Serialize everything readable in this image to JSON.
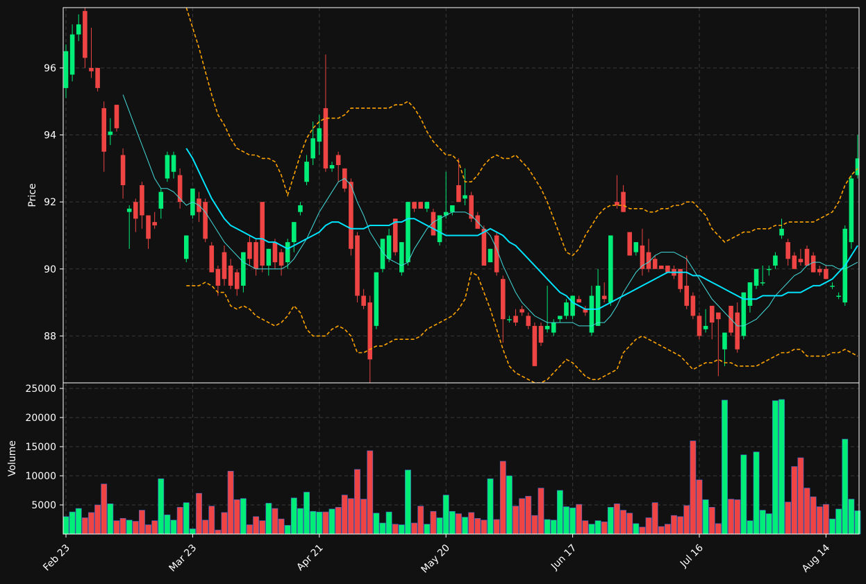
{
  "chart_data": {
    "type": "candlestick",
    "colors": {
      "background": "#111111",
      "up": "#00ee77",
      "down": "#ee4444",
      "volume_edge": "#4466cc",
      "ma_fast": "#44dddd",
      "ma_slow": "#00e5ff",
      "bollinger": "#ffa500",
      "grid": "#3a3a3a",
      "text": "#ffffff"
    },
    "price_panel": {
      "ylabel": "Price",
      "ylim": [
        86.6,
        97.8
      ],
      "yticks": [
        88,
        90,
        92,
        94,
        96
      ]
    },
    "volume_panel": {
      "ylabel": "Volume",
      "ylim": [
        0,
        25000
      ],
      "yticks": [
        5000,
        10000,
        15000,
        20000,
        25000
      ]
    },
    "x_ticks": [
      {
        "index": 0,
        "label": "Feb 23"
      },
      {
        "index": 20,
        "label": "Mar 23"
      },
      {
        "index": 40,
        "label": "Apr 21"
      },
      {
        "index": 60,
        "label": "May 20"
      },
      {
        "index": 80,
        "label": "Jun 17"
      },
      {
        "index": 100,
        "label": "Jul 16"
      },
      {
        "index": 120,
        "label": "Aug 14"
      }
    ],
    "ohlc": [
      [
        95.4,
        96.7,
        95.1,
        96.5
      ],
      [
        95.8,
        97.3,
        95.6,
        97.0
      ],
      [
        97.0,
        97.6,
        96.8,
        97.3
      ],
      [
        97.7,
        98.0,
        96.0,
        96.3
      ],
      [
        96.0,
        97.2,
        95.7,
        95.9
      ],
      [
        96.0,
        96.0,
        95.3,
        95.4
      ],
      [
        94.8,
        95.0,
        92.9,
        93.5
      ],
      [
        94.0,
        94.5,
        93.7,
        94.1
      ],
      [
        94.9,
        94.9,
        94.1,
        94.2
      ],
      [
        93.4,
        93.6,
        92.1,
        92.5
      ],
      [
        91.7,
        91.9,
        90.6,
        91.8
      ],
      [
        92.0,
        92.1,
        91.1,
        91.5
      ],
      [
        92.5,
        92.6,
        91.2,
        91.6
      ],
      [
        91.6,
        91.6,
        90.6,
        90.9
      ],
      [
        91.4,
        91.7,
        91.2,
        91.3
      ],
      [
        91.8,
        92.4,
        91.5,
        92.3
      ],
      [
        92.7,
        93.5,
        92.6,
        93.4
      ],
      [
        92.9,
        93.5,
        92.7,
        93.4
      ],
      [
        92.8,
        93.0,
        91.8,
        92.0
      ],
      [
        90.3,
        91.0,
        90.2,
        91.0
      ],
      [
        91.6,
        92.4,
        91.5,
        92.4
      ],
      [
        92.1,
        92.3,
        91.4,
        91.7
      ],
      [
        92.0,
        92.1,
        90.8,
        90.9
      ],
      [
        90.7,
        90.8,
        89.9,
        89.9
      ],
      [
        90.0,
        90.1,
        89.2,
        89.5
      ],
      [
        90.5,
        90.7,
        89.5,
        89.7
      ],
      [
        90.1,
        90.3,
        89.4,
        89.5
      ],
      [
        89.9,
        90.0,
        89.2,
        89.4
      ],
      [
        89.5,
        90.5,
        89.3,
        90.5
      ],
      [
        90.8,
        91.0,
        90.1,
        90.3
      ],
      [
        90.8,
        90.9,
        89.8,
        90.0
      ],
      [
        92.0,
        92.0,
        89.9,
        90.1
      ],
      [
        90.1,
        90.6,
        89.8,
        90.6
      ],
      [
        90.8,
        90.9,
        90.0,
        90.2
      ],
      [
        90.5,
        90.6,
        89.8,
        90.1
      ],
      [
        90.2,
        90.9,
        90.0,
        90.8
      ],
      [
        90.8,
        91.4,
        90.5,
        91.4
      ],
      [
        91.7,
        92.0,
        91.6,
        91.9
      ],
      [
        92.6,
        93.4,
        92.5,
        93.2
      ],
      [
        93.3,
        94.4,
        93.1,
        93.9
      ],
      [
        93.8,
        94.6,
        93.4,
        94.2
      ],
      [
        94.8,
        96.4,
        92.9,
        93.0
      ],
      [
        93.0,
        93.2,
        92.9,
        93.1
      ],
      [
        93.4,
        93.5,
        92.6,
        93.1
      ],
      [
        93.0,
        93.0,
        92.3,
        92.4
      ],
      [
        92.6,
        92.7,
        90.4,
        90.6
      ],
      [
        91.0,
        91.1,
        89.0,
        89.2
      ],
      [
        89.2,
        89.4,
        88.8,
        88.9
      ],
      [
        89.0,
        89.2,
        86.5,
        87.3
      ],
      [
        88.3,
        89.9,
        88.2,
        89.9
      ],
      [
        90.0,
        90.9,
        89.9,
        90.9
      ],
      [
        90.3,
        91.2,
        90.2,
        91.0
      ],
      [
        91.5,
        91.5,
        90.4,
        90.5
      ],
      [
        89.9,
        90.8,
        89.8,
        90.8
      ],
      [
        90.2,
        92.0,
        90.1,
        92.0
      ],
      [
        92.0,
        92.0,
        91.7,
        91.8
      ],
      [
        92.0,
        92.0,
        91.8,
        91.8
      ],
      [
        91.8,
        92.0,
        91.7,
        92.0
      ],
      [
        91.7,
        91.8,
        91.0,
        91.0
      ],
      [
        90.8,
        91.6,
        90.7,
        91.6
      ],
      [
        91.6,
        92.9,
        91.5,
        91.7
      ],
      [
        91.7,
        91.8,
        91.6,
        91.9
      ],
      [
        92.5,
        93.3,
        92.0,
        92.0
      ],
      [
        92.1,
        93.0,
        91.9,
        92.2
      ],
      [
        92.2,
        92.3,
        91.4,
        91.5
      ],
      [
        91.6,
        91.7,
        91.2,
        91.2
      ],
      [
        91.2,
        91.3,
        90.1,
        90.1
      ],
      [
        90.2,
        90.6,
        90.2,
        90.6
      ],
      [
        91.0,
        91.1,
        89.8,
        89.9
      ],
      [
        89.7,
        89.8,
        87.8,
        88.5
      ],
      [
        88.5,
        88.6,
        88.4,
        88.5
      ],
      [
        88.6,
        88.8,
        88.3,
        88.4
      ],
      [
        88.8,
        88.9,
        88.6,
        88.7
      ],
      [
        88.6,
        88.7,
        88.2,
        88.3
      ],
      [
        88.3,
        88.4,
        87.1,
        87.1
      ],
      [
        88.3,
        88.4,
        87.7,
        87.8
      ],
      [
        88.2,
        89.5,
        88.1,
        88.3
      ],
      [
        88.1,
        88.5,
        88.0,
        88.4
      ],
      [
        88.5,
        88.6,
        88.4,
        88.6
      ],
      [
        88.6,
        89.1,
        88.5,
        89.0
      ],
      [
        88.6,
        89.2,
        88.5,
        89.2
      ],
      [
        89.1,
        89.2,
        89.0,
        89.0
      ],
      [
        88.8,
        88.9,
        88.6,
        88.7
      ],
      [
        88.1,
        89.5,
        88.0,
        89.2
      ],
      [
        88.3,
        90.0,
        88.3,
        89.5
      ],
      [
        89.2,
        89.6,
        89.0,
        89.1
      ],
      [
        89.0,
        91.0,
        88.9,
        91.0
      ],
      [
        92.0,
        92.8,
        91.8,
        91.9
      ],
      [
        92.3,
        92.5,
        91.7,
        91.7
      ],
      [
        91.1,
        91.1,
        90.4,
        90.4
      ],
      [
        90.5,
        90.8,
        90.4,
        90.8
      ],
      [
        90.7,
        91.2,
        89.8,
        90.0
      ],
      [
        90.5,
        90.9,
        89.9,
        90.0
      ],
      [
        90.3,
        90.4,
        90.0,
        90.0
      ],
      [
        90.1,
        90.1,
        90.0,
        90.0
      ],
      [
        90.1,
        90.1,
        89.9,
        89.9
      ],
      [
        90.0,
        90.1,
        89.7,
        89.8
      ],
      [
        90.0,
        90.0,
        89.3,
        89.4
      ],
      [
        89.5,
        90.4,
        88.8,
        88.9
      ],
      [
        89.2,
        89.3,
        88.5,
        88.6
      ],
      [
        88.6,
        88.7,
        87.9,
        88.0
      ],
      [
        88.2,
        88.8,
        88.1,
        88.3
      ],
      [
        88.9,
        88.9,
        87.9,
        88.4
      ],
      [
        88.7,
        88.7,
        86.8,
        88.5
      ],
      [
        87.6,
        88.1,
        87.1,
        88.1
      ],
      [
        88.9,
        88.9,
        88.0,
        88.1
      ],
      [
        88.7,
        89.0,
        87.5,
        87.6
      ],
      [
        88.0,
        89.3,
        87.9,
        89.3
      ],
      [
        88.9,
        89.6,
        88.7,
        89.6
      ],
      [
        89.5,
        90.0,
        89.4,
        90.0
      ],
      [
        89.6,
        90.1,
        89.5,
        89.6
      ],
      [
        90.0,
        90.1,
        89.8,
        90.0
      ],
      [
        90.1,
        90.5,
        90.0,
        90.4
      ],
      [
        91.0,
        91.5,
        90.9,
        91.2
      ],
      [
        90.8,
        90.9,
        90.1,
        90.3
      ],
      [
        90.4,
        90.5,
        90.0,
        90.0
      ],
      [
        90.3,
        90.6,
        90.1,
        90.2
      ],
      [
        90.6,
        90.7,
        90.1,
        90.1
      ],
      [
        90.4,
        90.5,
        89.9,
        89.9
      ],
      [
        90.0,
        90.1,
        89.8,
        89.9
      ],
      [
        90.0,
        90.1,
        89.7,
        89.7
      ],
      [
        89.5,
        89.6,
        89.4,
        89.5
      ],
      [
        89.2,
        89.3,
        89.1,
        89.2
      ],
      [
        89.0,
        91.3,
        88.9,
        91.2
      ],
      [
        90.8,
        92.8,
        90.6,
        92.7
      ],
      [
        92.8,
        94.0,
        92.7,
        93.3
      ]
    ],
    "volume": [
      3000,
      3800,
      4400,
      2800,
      3700,
      5000,
      8600,
      5200,
      2300,
      2700,
      2400,
      2200,
      4100,
      1600,
      2300,
      9500,
      3300,
      2400,
      4600,
      5400,
      900,
      7000,
      2400,
      4800,
      700,
      3700,
      10800,
      5900,
      6100,
      1600,
      3000,
      2300,
      5300,
      4400,
      2600,
      1500,
      6200,
      4400,
      7200,
      3900,
      3800,
      3800,
      4300,
      4600,
      6700,
      6100,
      11100,
      6000,
      14300,
      3600,
      1900,
      3800,
      1700,
      1600,
      11000,
      1900,
      4800,
      1700,
      3900,
      2800,
      6700,
      3900,
      3500,
      2900,
      3700,
      2700,
      2400,
      9500,
      2500,
      12500,
      10000,
      4800,
      6100,
      6500,
      3200,
      7900,
      2500,
      2400,
      7500,
      4700,
      4500,
      5100,
      2300,
      1700,
      2300,
      2100,
      4600,
      5200,
      4100,
      3600,
      1800,
      1200,
      2800,
      5400,
      1300,
      1700,
      3200,
      3000,
      4900,
      16000,
      9300,
      5900,
      4600,
      1800,
      23000,
      6000,
      5900,
      13600,
      2300,
      14100,
      4100,
      3500,
      22900,
      23100,
      5500,
      11600,
      13100,
      7900,
      6400,
      4700,
      5100,
      2600,
      4300,
      16300,
      6000,
      4000
    ],
    "ma_fast": [
      null,
      null,
      null,
      null,
      null,
      null,
      null,
      null,
      null,
      95.2,
      94.7,
      94.2,
      93.7,
      93.2,
      92.7,
      92.4,
      92.4,
      92.3,
      92.1,
      91.9,
      92.0,
      91.9,
      91.7,
      91.4,
      91.1,
      90.8,
      90.6,
      90.4,
      90.2,
      90.1,
      90.0,
      90.0,
      90.0,
      90.0,
      90.0,
      90.1,
      90.3,
      90.6,
      90.9,
      91.3,
      91.7,
      92.0,
      92.3,
      92.6,
      92.7,
      92.5,
      92.0,
      91.6,
      91.1,
      90.8,
      90.5,
      90.3,
      90.2,
      90.1,
      90.2,
      90.6,
      90.9,
      91.2,
      91.4,
      91.5,
      91.6,
      91.7,
      91.7,
      91.7,
      91.6,
      91.4,
      91.2,
      91.0,
      90.6,
      90.1,
      89.7,
      89.3,
      89.0,
      88.8,
      88.6,
      88.5,
      88.4,
      88.4,
      88.4,
      88.4,
      88.4,
      88.3,
      88.3,
      88.3,
      88.4,
      88.4,
      88.6,
      88.9,
      89.3,
      89.6,
      89.9,
      90.1,
      90.2,
      90.4,
      90.5,
      90.5,
      90.5,
      90.4,
      90.3,
      90.0,
      89.7,
      89.4,
      89.1,
      88.9,
      88.7,
      88.5,
      88.3,
      88.3,
      88.4,
      88.5,
      88.7,
      88.9,
      89.2,
      89.4,
      89.6,
      89.8,
      89.9,
      90.1,
      90.2,
      90.2,
      90.1,
      90.1,
      90.0,
      90.0,
      90.1,
      90.2
    ],
    "ma_slow": [
      null,
      null,
      null,
      null,
      null,
      null,
      null,
      null,
      null,
      null,
      null,
      null,
      null,
      null,
      null,
      null,
      null,
      null,
      null,
      93.6,
      93.3,
      92.9,
      92.5,
      92.1,
      91.8,
      91.5,
      91.3,
      91.2,
      91.1,
      91.0,
      90.9,
      90.9,
      90.8,
      90.8,
      90.7,
      90.6,
      90.7,
      90.8,
      90.9,
      91.0,
      91.1,
      91.3,
      91.4,
      91.4,
      91.3,
      91.2,
      91.2,
      91.2,
      91.3,
      91.3,
      91.3,
      91.3,
      91.4,
      91.4,
      91.5,
      91.5,
      91.4,
      91.3,
      91.2,
      91.1,
      91.0,
      91.0,
      91.0,
      91.0,
      91.0,
      91.0,
      91.1,
      91.2,
      91.1,
      91.0,
      90.8,
      90.7,
      90.5,
      90.3,
      90.1,
      89.9,
      89.7,
      89.5,
      89.3,
      89.2,
      89.0,
      88.9,
      88.8,
      88.8,
      88.8,
      88.9,
      89.0,
      89.1,
      89.2,
      89.3,
      89.4,
      89.5,
      89.6,
      89.7,
      89.8,
      89.9,
      89.9,
      89.9,
      89.9,
      89.8,
      89.8,
      89.7,
      89.6,
      89.5,
      89.4,
      89.3,
      89.2,
      89.1,
      89.1,
      89.1,
      89.2,
      89.2,
      89.2,
      89.2,
      89.3,
      89.3,
      89.3,
      89.4,
      89.5,
      89.5,
      89.6,
      89.7,
      89.9,
      90.1,
      90.4,
      90.7
    ],
    "bb_upper": [
      null,
      null,
      null,
      null,
      null,
      null,
      null,
      null,
      null,
      null,
      null,
      null,
      null,
      null,
      null,
      null,
      null,
      null,
      null,
      97.8,
      97.2,
      96.6,
      95.9,
      95.2,
      94.6,
      94.3,
      93.9,
      93.6,
      93.5,
      93.4,
      93.4,
      93.3,
      93.3,
      93.2,
      92.8,
      92.2,
      92.8,
      93.4,
      93.9,
      94.2,
      94.4,
      94.5,
      94.5,
      94.5,
      94.6,
      94.8,
      94.8,
      94.8,
      94.8,
      94.8,
      94.8,
      94.8,
      94.9,
      94.9,
      95.0,
      94.8,
      94.5,
      94.1,
      93.8,
      93.6,
      93.4,
      93.4,
      93.2,
      92.6,
      92.6,
      92.8,
      93.1,
      93.3,
      93.4,
      93.3,
      93.3,
      93.4,
      93.2,
      93.0,
      92.7,
      92.4,
      92.0,
      91.5,
      91.0,
      90.5,
      90.4,
      90.6,
      91.0,
      91.3,
      91.6,
      91.8,
      91.9,
      91.9,
      91.9,
      91.8,
      91.8,
      91.8,
      91.7,
      91.7,
      91.8,
      91.8,
      91.9,
      91.9,
      92.0,
      92.0,
      91.8,
      91.6,
      91.2,
      91.0,
      90.8,
      90.9,
      91.0,
      91.1,
      91.1,
      91.2,
      91.2,
      91.2,
      91.3,
      91.3,
      91.4,
      91.4,
      91.4,
      91.4,
      91.4,
      91.5,
      91.6,
      91.7,
      92.0,
      92.5,
      92.8,
      93.0
    ],
    "bb_lower": [
      null,
      null,
      null,
      null,
      null,
      null,
      null,
      null,
      null,
      null,
      null,
      null,
      null,
      null,
      null,
      null,
      null,
      null,
      null,
      89.5,
      89.5,
      89.5,
      89.6,
      89.5,
      89.3,
      89.3,
      88.9,
      88.8,
      88.9,
      88.8,
      88.6,
      88.5,
      88.4,
      88.3,
      88.4,
      88.6,
      88.9,
      88.7,
      88.2,
      88.0,
      88.0,
      88.0,
      88.2,
      88.3,
      88.2,
      88.0,
      87.5,
      87.5,
      87.6,
      87.7,
      87.7,
      87.8,
      87.9,
      87.9,
      87.9,
      87.9,
      88.0,
      88.2,
      88.3,
      88.4,
      88.5,
      88.6,
      88.8,
      89.1,
      89.9,
      89.8,
      89.3,
      88.8,
      88.2,
      87.6,
      87.1,
      86.9,
      86.8,
      86.7,
      86.6,
      86.6,
      86.7,
      86.9,
      87.1,
      87.3,
      87.2,
      87.0,
      86.8,
      86.7,
      86.7,
      86.8,
      86.9,
      87.0,
      87.5,
      87.7,
      87.9,
      88.0,
      87.9,
      87.8,
      87.7,
      87.6,
      87.5,
      87.4,
      87.2,
      87.0,
      87.1,
      87.2,
      87.2,
      87.3,
      87.2,
      87.2,
      87.1,
      87.1,
      87.1,
      87.1,
      87.2,
      87.3,
      87.4,
      87.5,
      87.5,
      87.6,
      87.6,
      87.4,
      87.4,
      87.4,
      87.4,
      87.5,
      87.5,
      87.6,
      87.5,
      87.4
    ]
  }
}
